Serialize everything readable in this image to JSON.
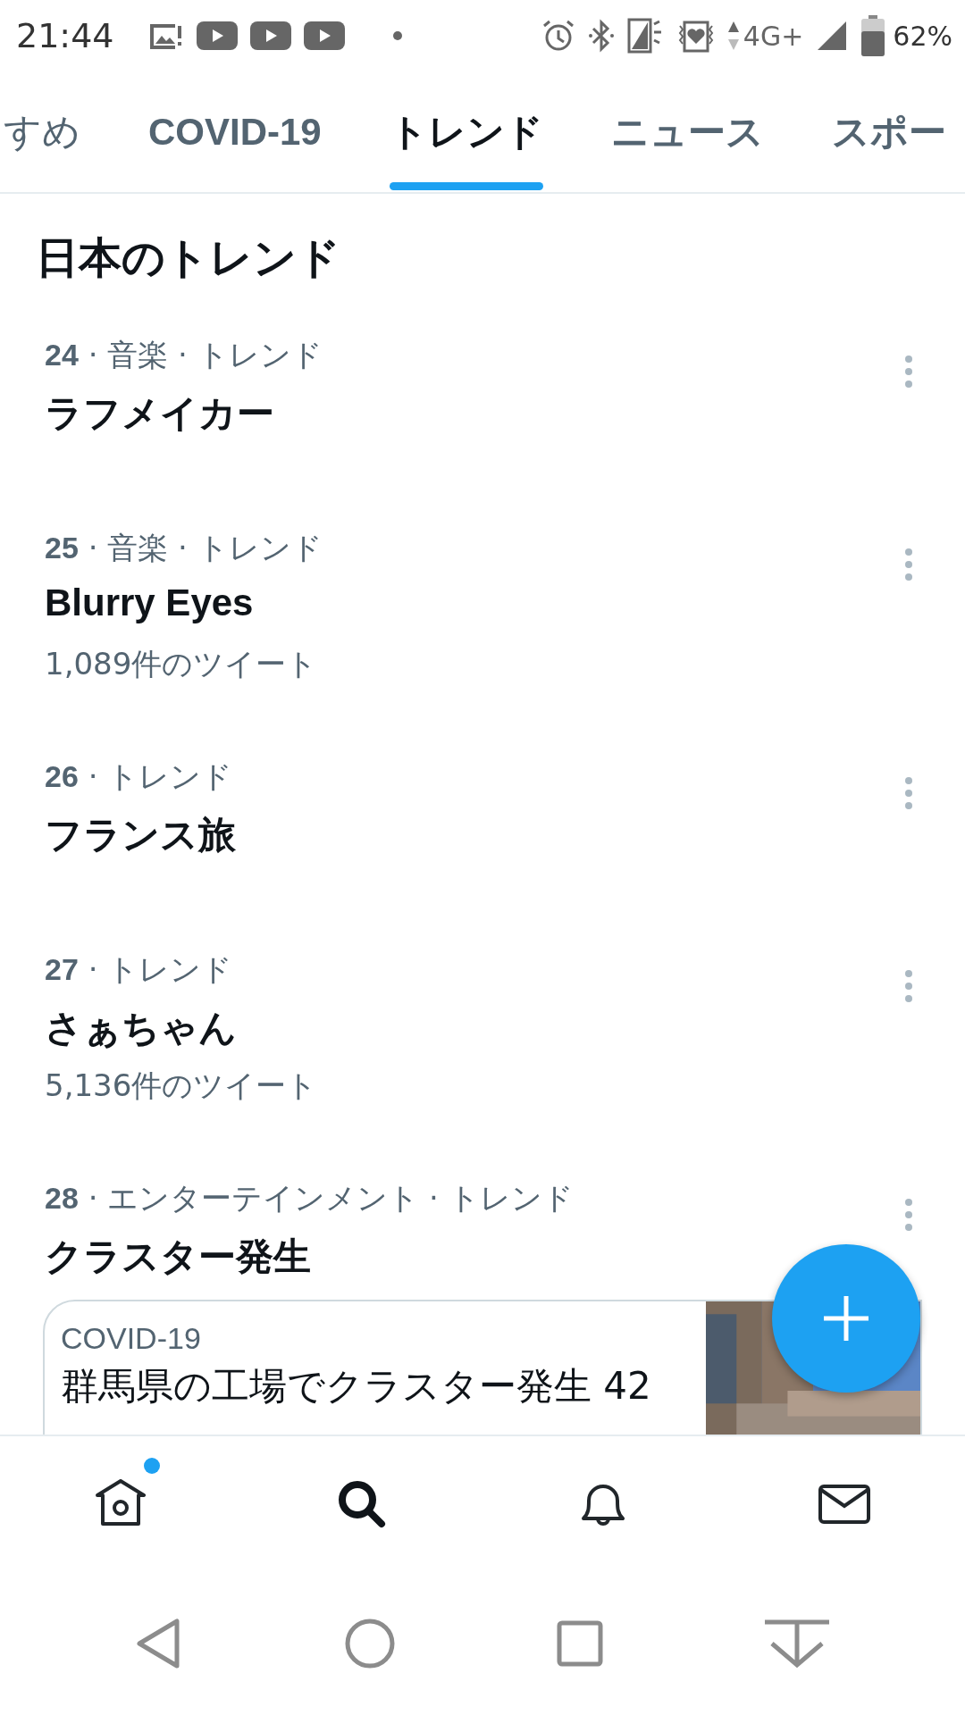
{
  "status_bar": {
    "time": "21:44",
    "network": "4G+",
    "battery": "62%"
  },
  "tabs": [
    {
      "label": "すめ",
      "selected": false
    },
    {
      "label": "COVID-19",
      "selected": false
    },
    {
      "label": "トレンド",
      "selected": true
    },
    {
      "label": "ニュース",
      "selected": false
    },
    {
      "label": "スポー",
      "selected": false
    }
  ],
  "section_title": "日本のトレンド",
  "trends": [
    {
      "rank": "24",
      "context": " · 音楽 · トレンド",
      "title": "ラフメイカー"
    },
    {
      "rank": "25",
      "context": " · 音楽 · トレンド",
      "title": "Blurry Eyes",
      "count": "1,089件のツイート"
    },
    {
      "rank": "26",
      "context": " · トレンド",
      "title": "フランス旅"
    },
    {
      "rank": "27",
      "context": " · トレンド",
      "title": "さぁちゃん",
      "count": "5,136件のツイート"
    },
    {
      "rank": "28",
      "context": " · エンターテインメント · トレンド",
      "title": "クラスター発生"
    }
  ],
  "news_card": {
    "topic": "COVID-19",
    "headline": "群馬県の工場でクラスター発生 42"
  },
  "bottom_nav": [
    {
      "kind": "home",
      "selected": false,
      "badge": true
    },
    {
      "kind": "search",
      "selected": true,
      "badge": false
    },
    {
      "kind": "notifications",
      "selected": false,
      "badge": false
    },
    {
      "kind": "messages",
      "selected": false,
      "badge": false
    }
  ]
}
